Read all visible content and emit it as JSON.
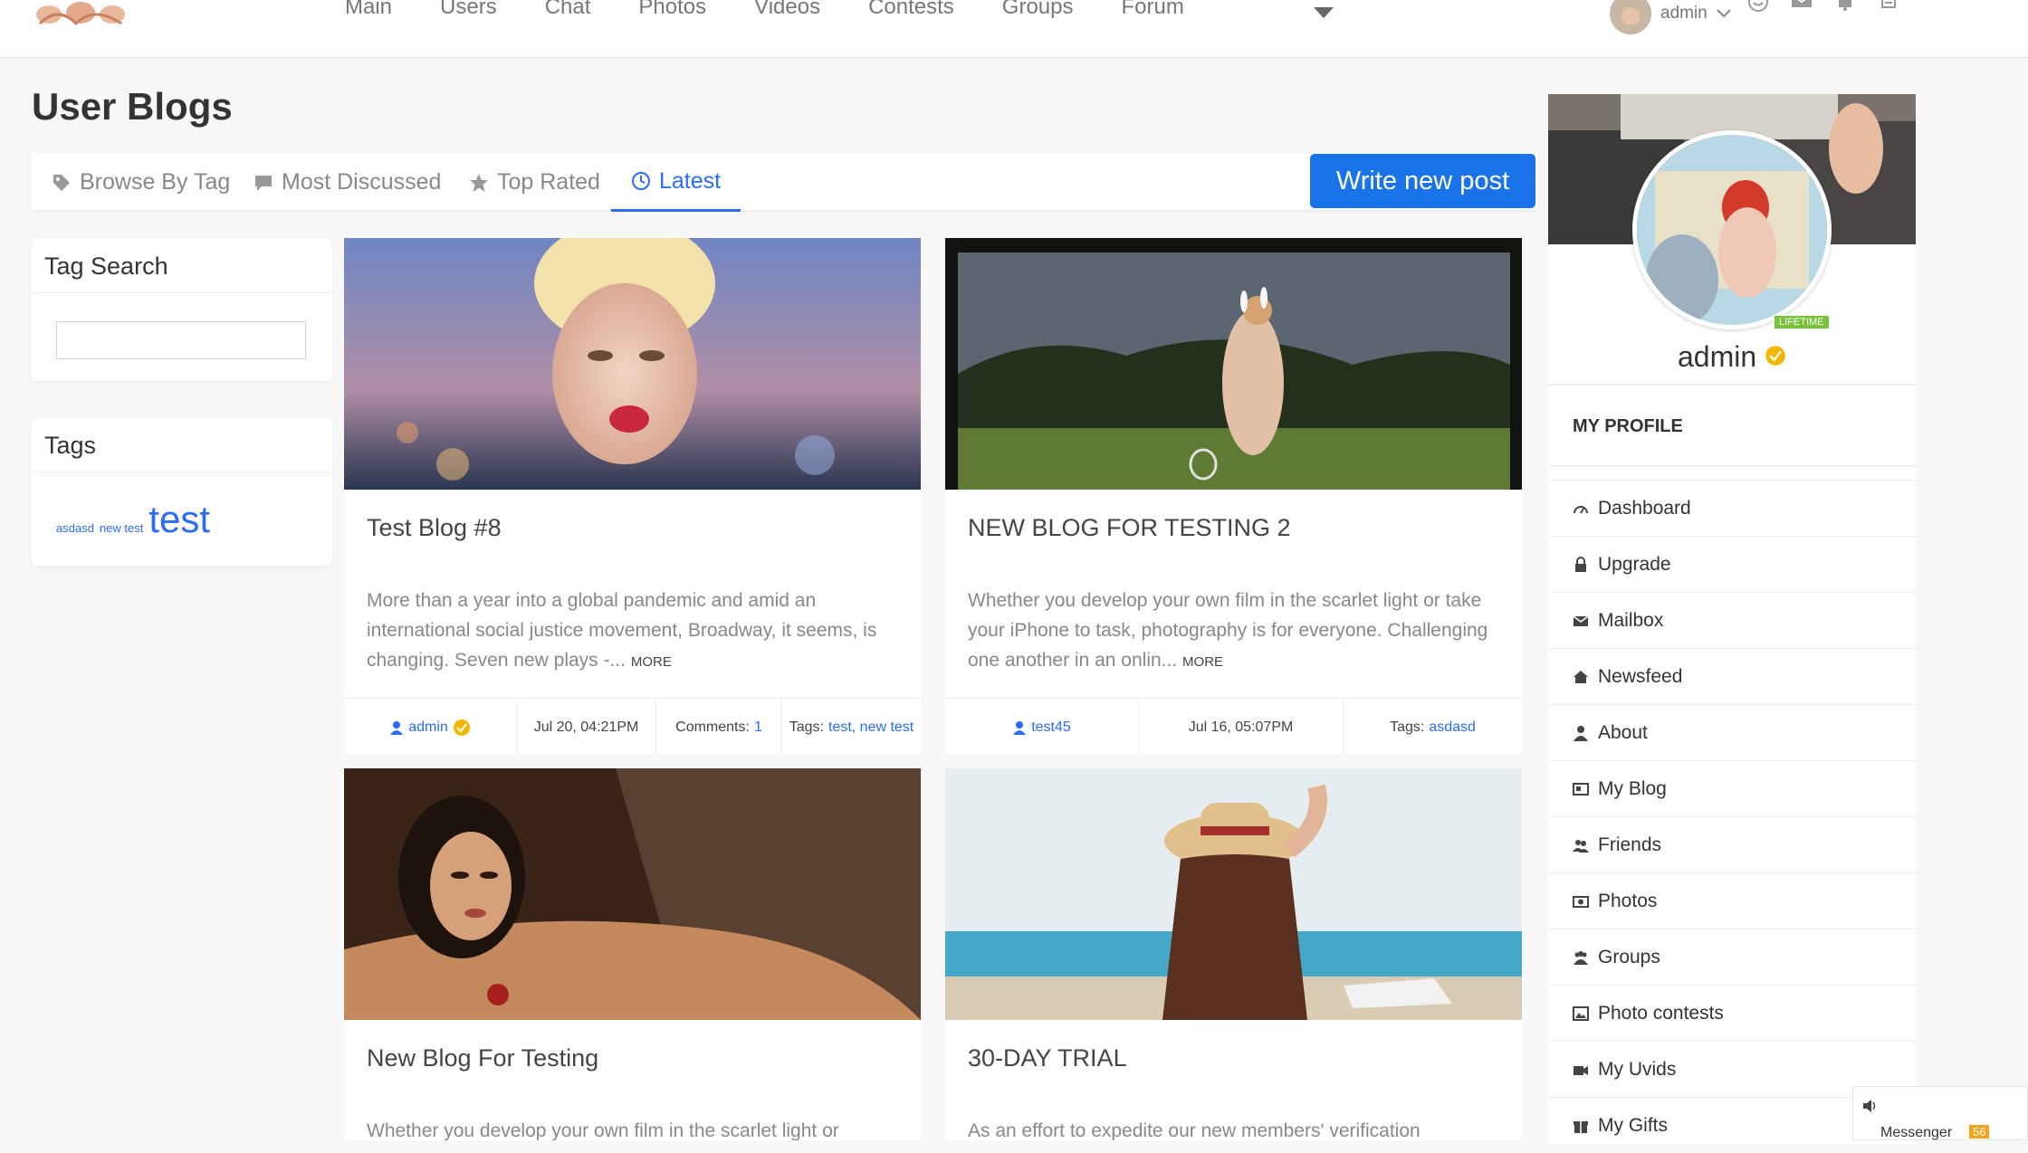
{
  "nav": {
    "items": [
      "Main",
      "Users",
      "Chat",
      "Photos",
      "Videos",
      "Contests",
      "Groups",
      "Forum"
    ]
  },
  "header": {
    "username": "admin"
  },
  "page": {
    "title": "User Blogs"
  },
  "tabs": [
    {
      "label": "Browse By Tag",
      "icon": "tag-icon"
    },
    {
      "label": "Most Discussed",
      "icon": "comment-icon"
    },
    {
      "label": "Top Rated",
      "icon": "star-icon"
    },
    {
      "label": "Latest",
      "icon": "clock-icon",
      "active": true
    }
  ],
  "write_button": "Write new post",
  "tag_search": {
    "title": "Tag Search"
  },
  "tags": {
    "title": "Tags",
    "items": [
      "asdasd",
      "new test",
      "test"
    ]
  },
  "posts": [
    {
      "title": "Test Blog #8",
      "excerpt": "More than a year into a global pandemic and amid an international social justice movement, Broadway, it seems, is changing. Seven new plays -...",
      "more": "MORE",
      "author": "admin",
      "date": "Jul 20, 04:21PM",
      "comments_label": "Comments:",
      "comments": "1",
      "tags_label": "Tags:",
      "tags": "test, new test"
    },
    {
      "title": "NEW BLOG FOR TESTING 2",
      "excerpt": "Whether you develop your own film in the scarlet light or take your iPhone to task, photography is for everyone. Challenging one another in an onlin...",
      "more": "MORE",
      "author": "test45",
      "date": "Jul 16, 05:07PM",
      "tags_label": "Tags:",
      "tags": "asdasd"
    },
    {
      "title": "New Blog For Testing",
      "excerpt": "Whether you develop your own film in the scarlet light or"
    },
    {
      "title": "30-DAY TRIAL",
      "excerpt": "As an effort to expedite our new members' verification"
    }
  ],
  "profile": {
    "name": "admin",
    "badge": "LIFETIME",
    "section": "MY PROFILE"
  },
  "menu": [
    {
      "label": "Dashboard",
      "icon": "dashboard-icon"
    },
    {
      "label": "Upgrade",
      "icon": "lock-icon"
    },
    {
      "label": "Mailbox",
      "icon": "envelope-icon"
    },
    {
      "label": "Newsfeed",
      "icon": "home-icon"
    },
    {
      "label": "About",
      "icon": "user-icon"
    },
    {
      "label": "My Blog",
      "icon": "blog-icon"
    },
    {
      "label": "Friends",
      "icon": "friends-icon"
    },
    {
      "label": "Photos",
      "icon": "camera-icon"
    },
    {
      "label": "Groups",
      "icon": "groups-icon"
    },
    {
      "label": "Photo contests",
      "icon": "picture-icon"
    },
    {
      "label": "My Uvids",
      "icon": "video-icon"
    },
    {
      "label": "My Gifts",
      "icon": "gift-icon"
    }
  ],
  "messenger": {
    "label": "Messenger",
    "count": "56"
  }
}
